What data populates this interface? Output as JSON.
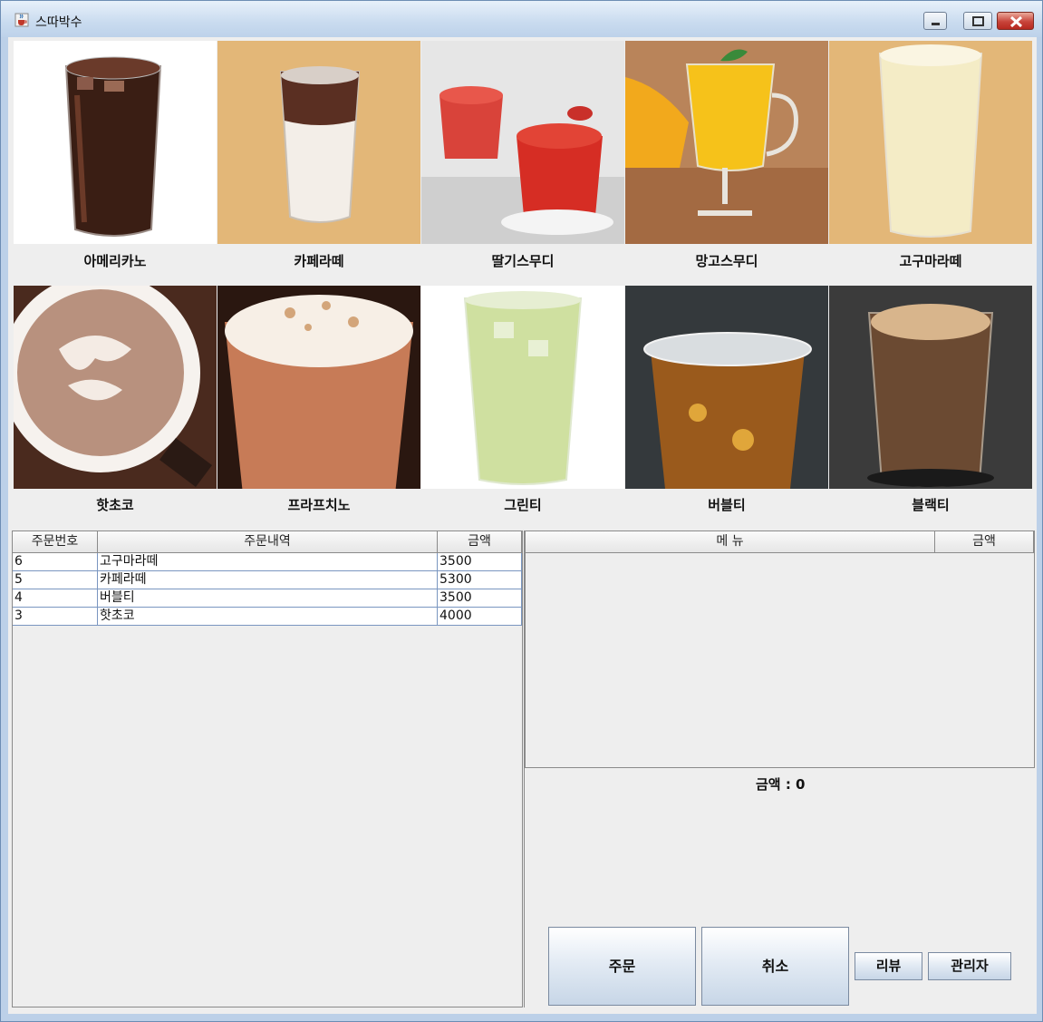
{
  "window": {
    "title": "스따박수"
  },
  "menu": {
    "row1": [
      {
        "name": "아메리카노"
      },
      {
        "name": "카페라떼"
      },
      {
        "name": "딸기스무디"
      },
      {
        "name": "망고스무디"
      },
      {
        "name": "고구마라떼"
      }
    ],
    "row2": [
      {
        "name": "핫초코"
      },
      {
        "name": "프라프치노"
      },
      {
        "name": "그린티"
      },
      {
        "name": "버블티"
      },
      {
        "name": "블랙티"
      }
    ]
  },
  "orders": {
    "headers": [
      "주문번호",
      "주문내역",
      "금액"
    ],
    "rows": [
      [
        "6",
        "고구마라떼",
        "3500"
      ],
      [
        "5",
        "카페라떼",
        "5300"
      ],
      [
        "4",
        "버블티",
        "3500"
      ],
      [
        "3",
        "핫초코",
        "4000"
      ]
    ]
  },
  "cart": {
    "headers": [
      "메 뉴",
      "금액"
    ],
    "total_label": "금액 : 0"
  },
  "buttons": {
    "order": "주문",
    "cancel": "취소",
    "review": "리뷰",
    "admin": "관리자"
  },
  "icons": {
    "title": "java-cup-icon",
    "minimize": "minimize-icon",
    "maximize": "maximize-icon",
    "close": "close-icon"
  },
  "colors": {
    "tile_tan": "#e3b778",
    "window_frame": "#bcd0e8",
    "close_red": "#c8443a"
  }
}
